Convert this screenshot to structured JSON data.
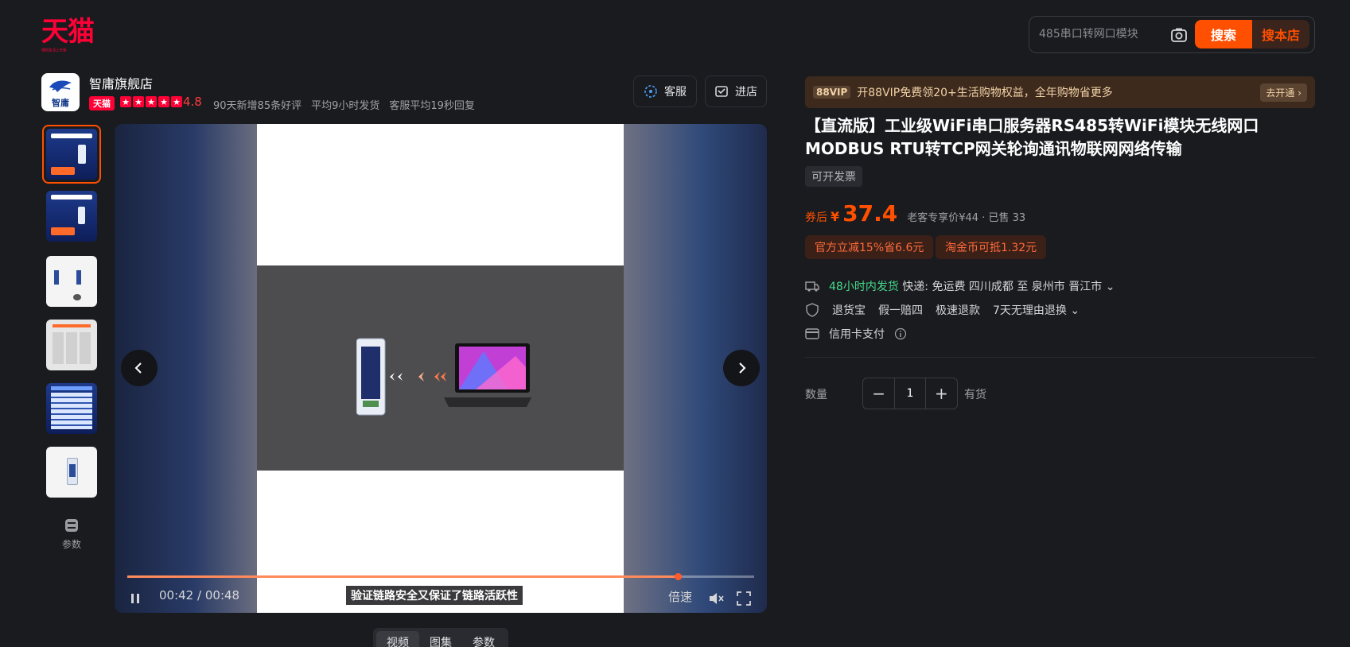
{
  "logo": {
    "text": "天猫",
    "slogan": "理想生活上天猫"
  },
  "search": {
    "placeholder": "485串口转网口模块",
    "search_label": "搜索",
    "store_label": "搜本店"
  },
  "store": {
    "name": "智庸旗舰店",
    "logo_text": "智庸",
    "tag": "天猫",
    "rating": "4.8",
    "stats": [
      "90天新增85条好评",
      "平均9小时发货",
      "客服平均19秒回复"
    ],
    "cs_label": "客服",
    "enter_label": "进店"
  },
  "gallery": {
    "params_label": "参数"
  },
  "video": {
    "caption": "验证链路安全又保证了链路活跃性",
    "current_time": "00:42",
    "separator": "/",
    "duration": "00:48",
    "progress": 0.878,
    "speed_label": "倍速"
  },
  "media_tabs": [
    "视频",
    "图集",
    "参数"
  ],
  "vip": {
    "badge": "88VIP",
    "text": "开88VIP免费领20+生活购物权益，全年购物省更多",
    "cta": "去开通 ›"
  },
  "product": {
    "title": "【直流版】工业级WiFi串口服务器RS485转WiFi模块无线网口MODBUS RTU转TCP网关轮询通讯物联网网络传输",
    "invoice": "可开发票",
    "price_prefix": "券后",
    "currency": "¥",
    "price": "37.4",
    "price_info": "老客专享价¥44 · 已售 33",
    "coupons": [
      "官方立减15%省6.6元",
      "淘金币可抵1.32元"
    ]
  },
  "services": {
    "shipping_highlight": "48小时内发货",
    "shipping_text": "快递: 免运费  四川成都 至 泉州市 晋江市",
    "guarantees": [
      "退货宝",
      "假一赔四",
      "极速退款",
      "7天无理由退换"
    ],
    "payment": "信用卡支付"
  },
  "purchase": {
    "qty_label": "数量",
    "qty_value": "1",
    "stock": "有货"
  },
  "colors": {
    "accent": "#ff4f00",
    "brand": "#ff0036",
    "green": "#45d98a"
  }
}
